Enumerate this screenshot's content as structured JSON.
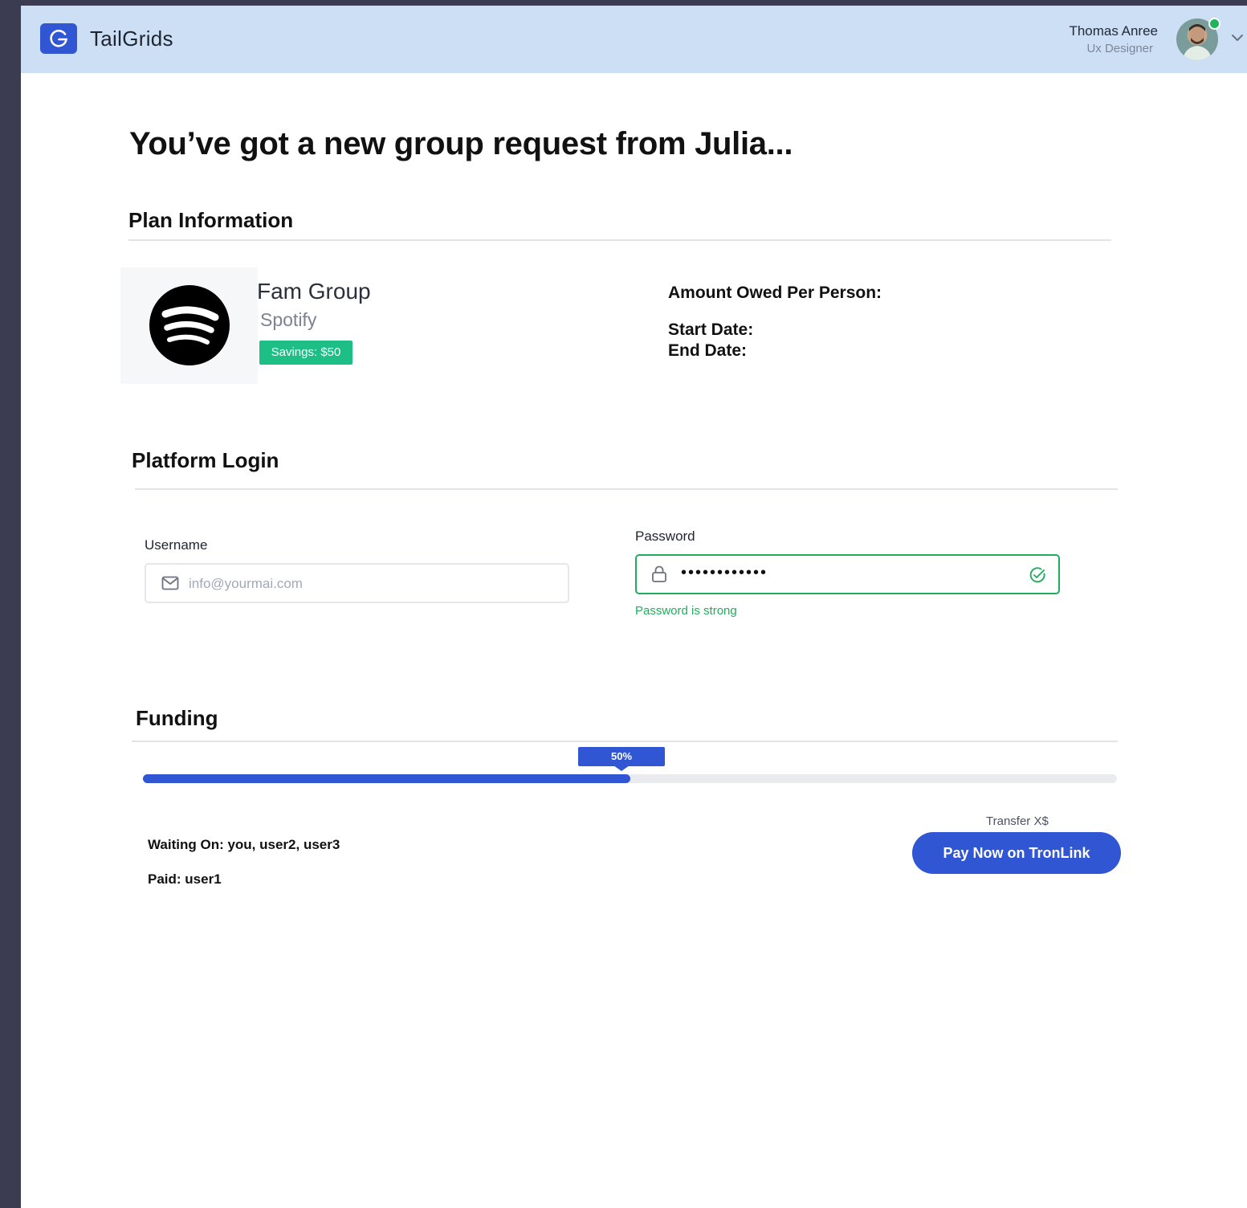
{
  "header": {
    "brand": "TailGrids",
    "user": {
      "name": "Thomas Anree",
      "role": "Ux Designer",
      "status_color": "#22b35f"
    }
  },
  "headline": "You’ve got a new group request from Julia...",
  "plan": {
    "section_title": "Plan Information",
    "name": "Fam Group",
    "provider": "Spotify",
    "provider_icon": "spotify-icon",
    "savings": "Savings:  $50",
    "amount_owed_label": "Amount Owed Per Person:",
    "start_date_label": "Start Date:",
    "end_date_label": "End Date:"
  },
  "login": {
    "section_title": "Platform Login",
    "username": {
      "label": "Username",
      "placeholder": "info@yourmai.com",
      "icon": "mail-icon"
    },
    "password": {
      "label": "Password",
      "value": "••••••••••••",
      "hint": "Password is strong",
      "icon": "lock-icon",
      "valid_icon": "check-circle-icon"
    }
  },
  "funding": {
    "section_title": "Funding",
    "progress": 50,
    "progress_label": "50%",
    "waiting_on": "Waiting On: you, user2, user3",
    "paid": "Paid: user1",
    "transfer_label": "Transfer X$",
    "pay_button": "Pay Now on TronLink"
  },
  "colors": {
    "primary": "#3056d3",
    "success": "#22ad5c",
    "savings": "#1dbf86",
    "header_bg": "#cddff4"
  }
}
